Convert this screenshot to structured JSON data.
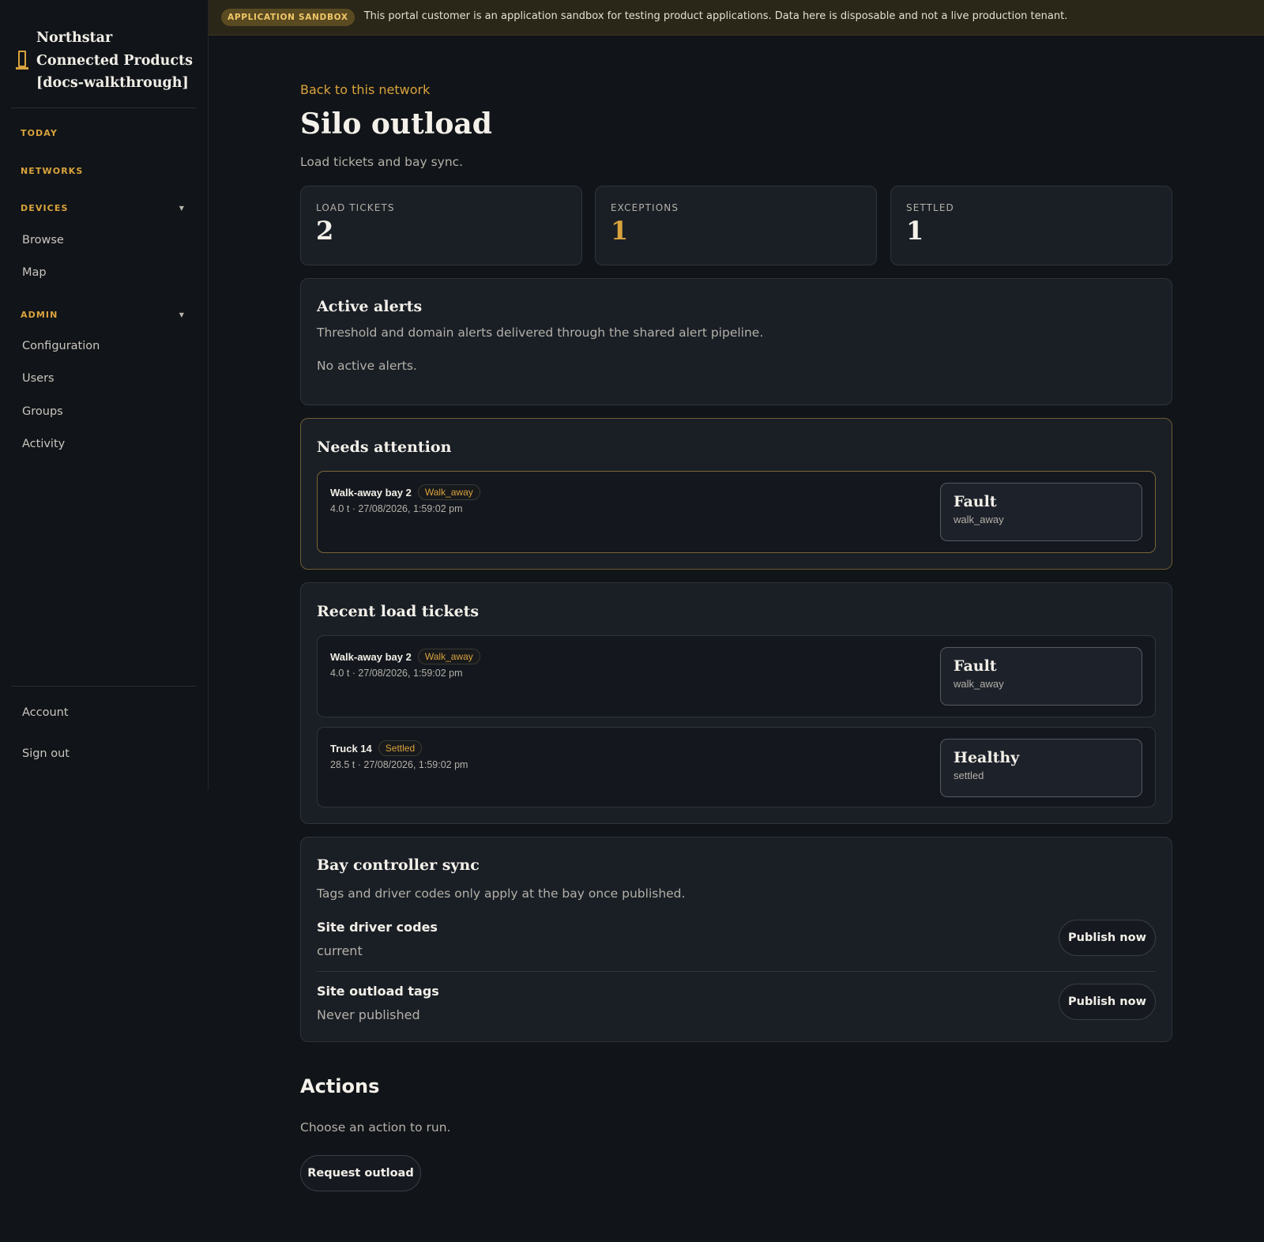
{
  "sidebar": {
    "brand_name": "Northstar Connected Products [docs-walkthrough]",
    "brand_icon": "bay-tower-icon",
    "sections": {
      "today": "TODAY",
      "networks": "NETWORKS",
      "devices": "DEVICES",
      "admin": "ADMIN"
    },
    "devices_items": [
      "Browse",
      "Map"
    ],
    "admin_items": [
      "Configuration",
      "Users",
      "Groups",
      "Activity"
    ],
    "account": "Account",
    "sign_out": "Sign out"
  },
  "banner": {
    "pill": "APPLICATION SANDBOX",
    "text": "This portal customer is an application sandbox for testing product applications. Data here is disposable and not a live production tenant."
  },
  "page": {
    "back_link": "Back to this network",
    "title": "Silo outload",
    "subtitle": "Load tickets and bay sync."
  },
  "stats": [
    {
      "label": "LOAD TICKETS",
      "value": "2"
    },
    {
      "label": "EXCEPTIONS",
      "value": "1"
    },
    {
      "label": "SETTLED",
      "value": "1"
    }
  ],
  "alerts": {
    "title": "Active alerts",
    "description": "Threshold and domain alerts delivered through the shared alert pipeline.",
    "empty": "No active alerts."
  },
  "needs_attention": {
    "title": "Needs attention",
    "tickets": [
      {
        "name": "Walk-away bay 2",
        "tag": "Walk_away",
        "meta": "4.0 t · 27/08/2026, 1:59:02 pm",
        "status": "Fault",
        "status_sub": "walk_away"
      }
    ]
  },
  "recent": {
    "title": "Recent load tickets",
    "tickets": [
      {
        "name": "Walk-away bay 2",
        "tag": "Walk_away",
        "meta": "4.0 t · 27/08/2026, 1:59:02 pm",
        "status": "Fault",
        "status_sub": "walk_away"
      },
      {
        "name": "Truck 14",
        "tag": "Settled",
        "meta": "28.5 t · 27/08/2026, 1:59:02 pm",
        "status": "Healthy",
        "status_sub": "settled"
      }
    ]
  },
  "sync": {
    "title": "Bay controller sync",
    "description": "Tags and driver codes only apply at the bay once published.",
    "rows": [
      {
        "label": "Site driver codes",
        "value": "current",
        "button": "Publish now"
      },
      {
        "label": "Site outload tags",
        "value": "Never published",
        "button": "Publish now"
      }
    ]
  },
  "actions": {
    "title": "Actions",
    "description": "Choose an action to run.",
    "button": "Request outload"
  },
  "colors": {
    "accent": "#d9a33d",
    "background": "#111418",
    "card": "#1a1f26"
  }
}
